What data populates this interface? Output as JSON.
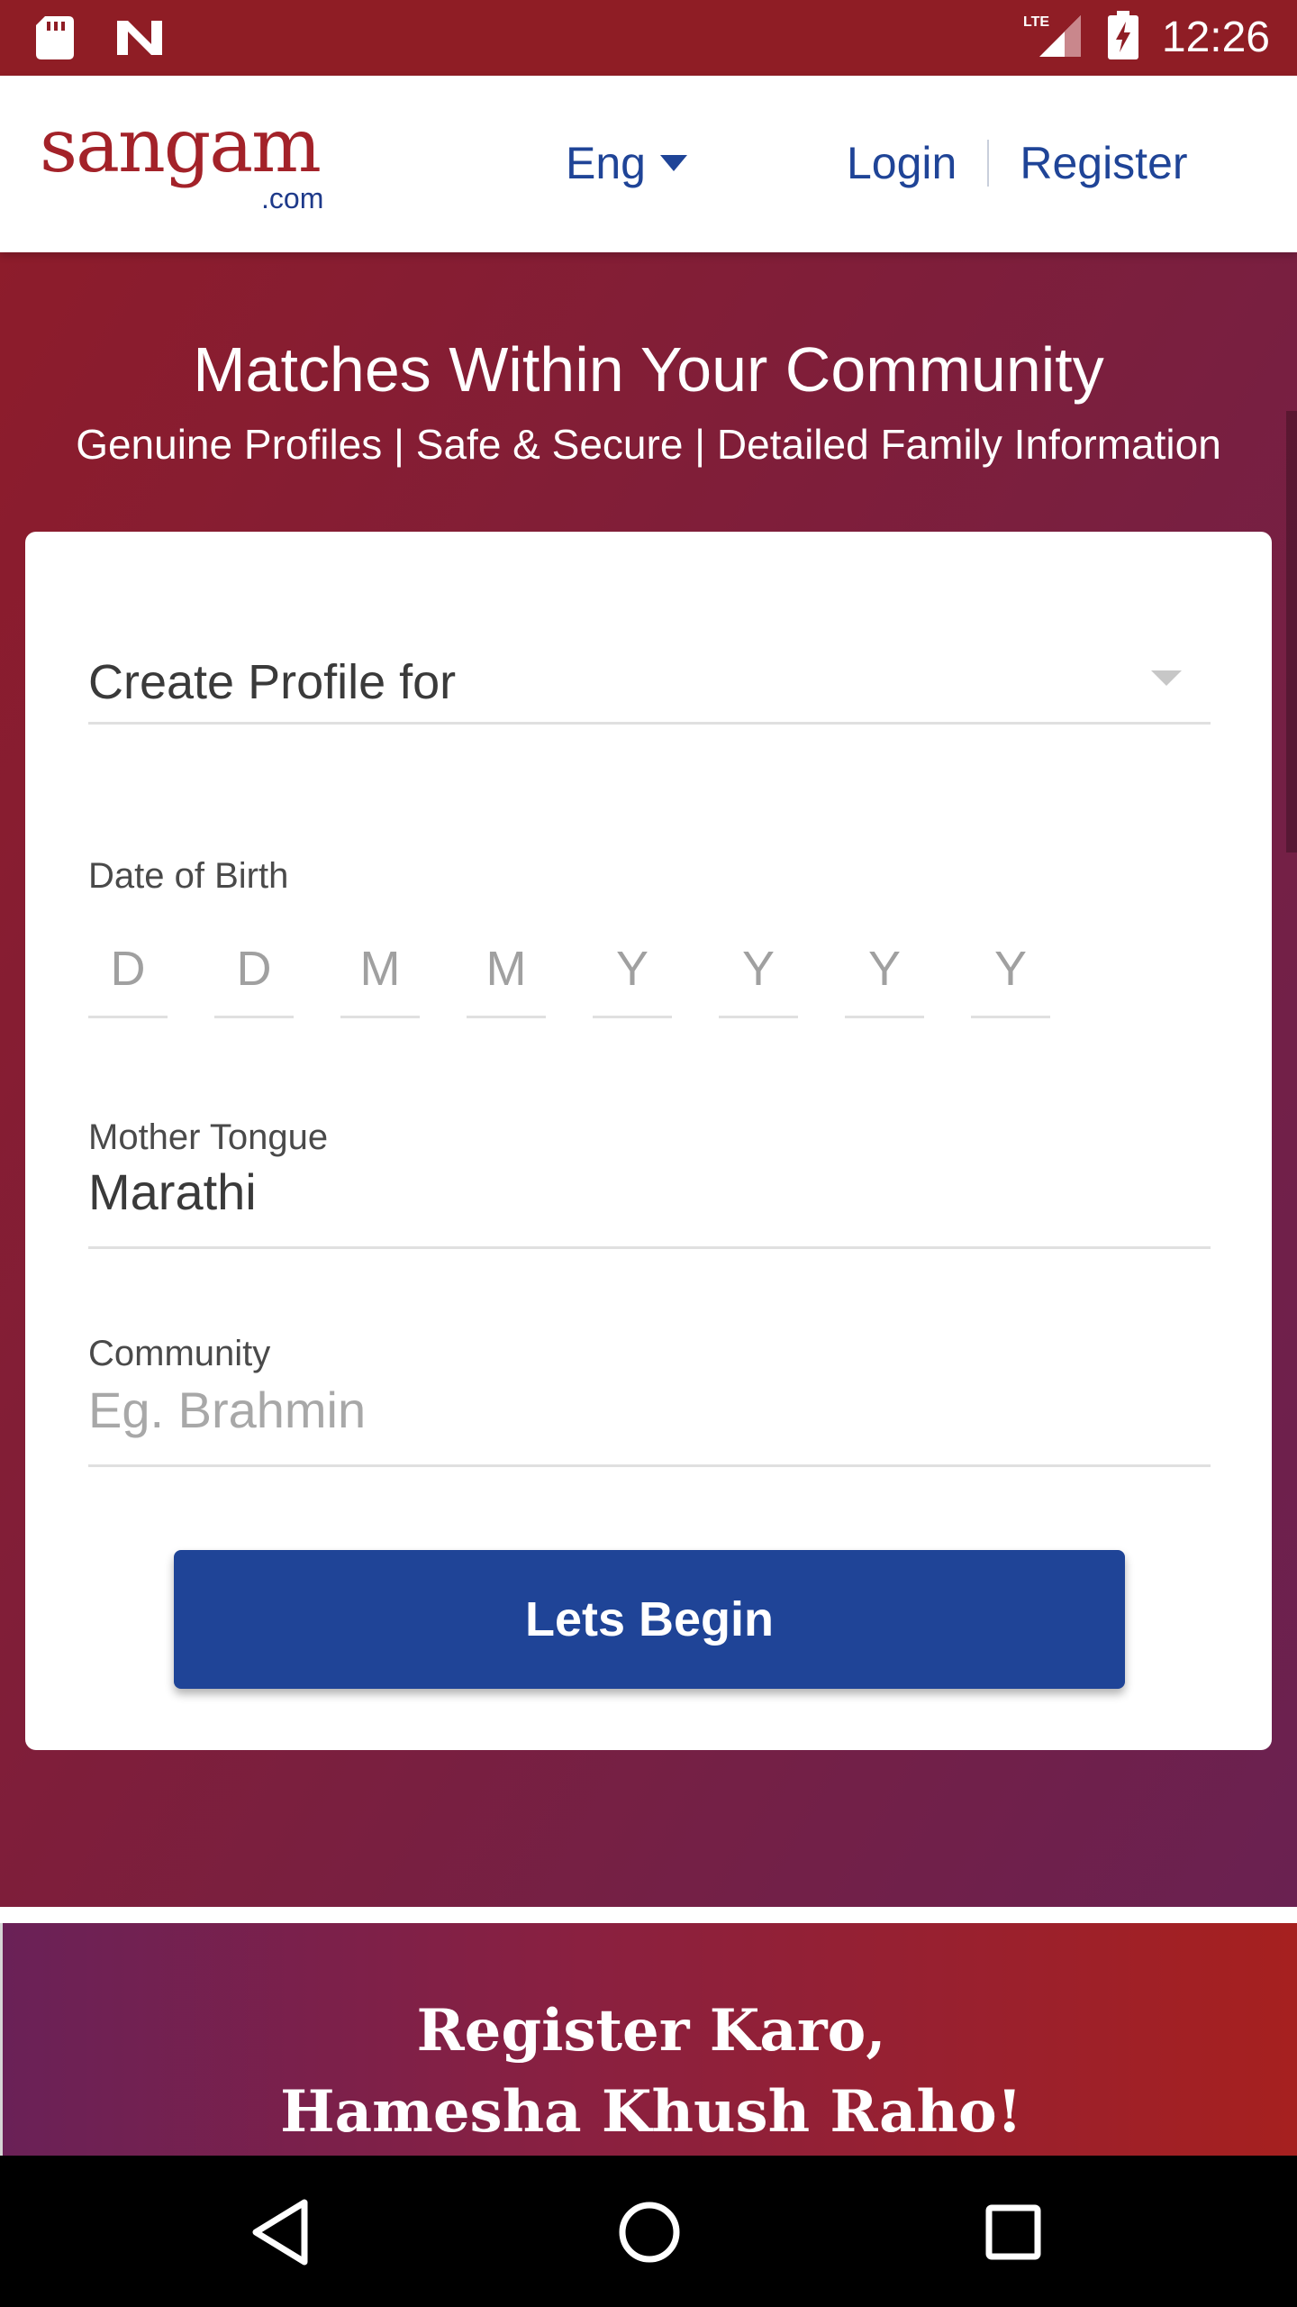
{
  "status_bar": {
    "time": "12:26",
    "network": "LTE",
    "icons": [
      "sd-card-icon",
      "n-notification-icon",
      "signal-icon",
      "battery-charging-icon"
    ]
  },
  "header": {
    "logo_text": "sangam",
    "logo_suffix": ".com",
    "language": "Eng",
    "login": "Login",
    "register": "Register"
  },
  "hero": {
    "title": "Matches Within Your Community",
    "subtitle": "Genuine Profiles | Safe & Secure | Detailed Family Information"
  },
  "form": {
    "profile_for_placeholder": "Create Profile for",
    "dob_label": "Date of Birth",
    "dob_placeholders": [
      "D",
      "D",
      "M",
      "M",
      "Y",
      "Y",
      "Y",
      "Y"
    ],
    "mother_tongue_label": "Mother Tongue",
    "mother_tongue_value": "Marathi",
    "community_label": "Community",
    "community_placeholder": "Eg. Brahmin",
    "submit_label": "Lets Begin"
  },
  "banner": {
    "line1": "Register Karo,",
    "line2": "Hamesha Khush Raho!"
  },
  "nav": {
    "icons": [
      "back-icon",
      "home-icon",
      "recents-icon"
    ]
  },
  "colors": {
    "brand_red": "#a32229",
    "link_blue": "#1f4497",
    "status_bar": "#8f1d25"
  }
}
